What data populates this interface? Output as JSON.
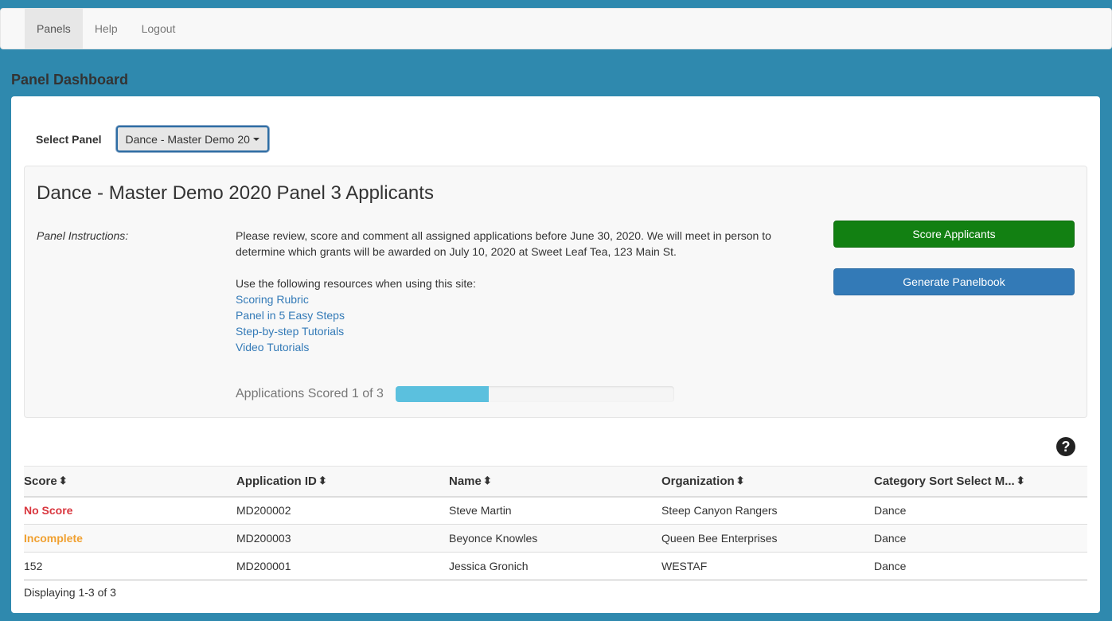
{
  "nav": {
    "items": [
      {
        "label": "Panels",
        "active": true
      },
      {
        "label": "Help",
        "active": false
      },
      {
        "label": "Logout",
        "active": false
      }
    ]
  },
  "page": {
    "title": "Panel Dashboard"
  },
  "panel_select": {
    "label": "Select Panel",
    "selected": "Dance - Master Demo 2020 Panel 3"
  },
  "panel": {
    "title": "Dance - Master Demo 2020 Panel 3 Applicants",
    "instructions_label": "Panel Instructions:",
    "instructions_text": "Please review, score and comment all assigned applications before June 30, 2020.  We will meet in person to determine which grants will be awarded on July 10, 2020 at Sweet Leaf Tea, 123 Main St.",
    "resources_intro": "Use the following resources when using this site:",
    "resources": [
      "Scoring Rubric",
      "Panel in 5 Easy Steps",
      "Step-by-step Tutorials",
      "Video Tutorials"
    ],
    "buttons": {
      "score": "Score Applicants",
      "panelbook": "Generate Panelbook"
    },
    "progress": {
      "label": "Applications Scored 1 of 3",
      "scored": 1,
      "total": 3,
      "fraction": 0.333
    },
    "colors": {
      "score_button": "#128012",
      "panelbook_button": "#337ab7",
      "progress_fill": "#5bc0de"
    }
  },
  "table": {
    "help_icon": "question-circle-icon",
    "columns": [
      "Score",
      "Application ID",
      "Name",
      "Organization",
      "Category Sort Select M..."
    ],
    "rows": [
      {
        "score": "No Score",
        "score_status": "noscore",
        "app_id": "MD200002",
        "name": "Steve Martin",
        "organization": "Steep Canyon Rangers",
        "category": "Dance"
      },
      {
        "score": "Incomplete",
        "score_status": "incomplete",
        "app_id": "MD200003",
        "name": "Beyonce Knowles",
        "organization": "Queen Bee Enterprises",
        "category": "Dance"
      },
      {
        "score": "152",
        "score_status": "scored",
        "app_id": "MD200001",
        "name": "Jessica Gronich",
        "organization": "WESTAF",
        "category": "Dance"
      }
    ],
    "footer": "Displaying 1-3 of 3",
    "status_colors": {
      "noscore": "#d9363e",
      "incomplete": "#f0a030"
    }
  }
}
